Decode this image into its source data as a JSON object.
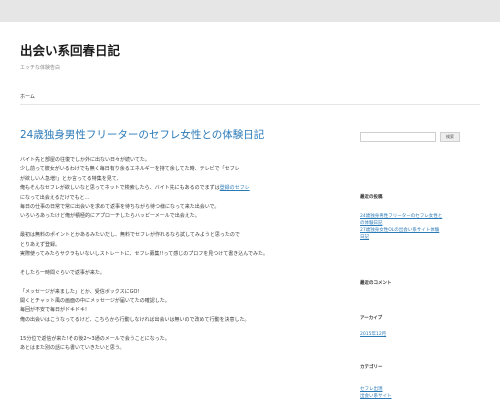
{
  "site": {
    "title": "出会い系回春日記",
    "description": "エッチな体験告白"
  },
  "nav": {
    "home": "ホーム"
  },
  "post": {
    "title": "24歳独身男性フリーターのセフレ女性との体験日記",
    "lines": [
      {
        "text": "バイト先と部屋の往復でしか外に出ない日々が続いてた。"
      },
      {
        "text": "少し前って彼女がいるわけでも無く毎日有り余るエネルギーを持て余してた時、テレビで「セフレ"
      },
      {
        "text": "が欲しい人急増!」とか言ってる特集を見て、"
      },
      {
        "text": "俺もそんなセフレが欲しいなと思ってネットで検索したら、バイト先にもあるのでまずは",
        "link": "登録のセフレ"
      },
      {
        "text": "になって出会えるだけでもと…"
      },
      {
        "text": "毎日の仕事の日常で常に出会いを求めて返事を待ちながら待つ様になって来た出会いで。"
      },
      {
        "text": "いろいろあったけど俺が積極的にアプローチしたらハッピーメールで出会えた。"
      },
      {
        "text": ""
      },
      {
        "text": "最初は無料のポイントとかあるみたいだし、無料でセフレが作れるなら試してみようと思ったので"
      },
      {
        "text": "とりあえず登録。"
      },
      {
        "text": "実際使ってみたらサクラもいないしストレートに、セフレ募集!!って感じのプロフを見つけて書き込んでみた。"
      },
      {
        "text": ""
      },
      {
        "text": "そしたら一時間ぐらいで返事が来た。"
      },
      {
        "text": ""
      },
      {
        "text": "「メッセージが来ました」とか、受信ボックスにGO!"
      },
      {
        "text": "開くとチャット風の画面の中にメッセージが届いてたの確認した。"
      },
      {
        "text": "毎回が不安で毎日がドキドキ!"
      },
      {
        "text": "俺の出会いはこうなってるけど、こちらから行動しなければ出会いは無いので改めて行動を決意した。"
      },
      {
        "text": ""
      },
      {
        "text": "15分位で返信が来た!その後2～3通のメールで会うことになった。"
      },
      {
        "text": "あとはまた別の話にも書いていきたいと思う。"
      }
    ]
  },
  "sidebar": {
    "search_button": "検索",
    "search_value": "",
    "recent_posts_title": "最近の投稿",
    "recent_posts": [
      "24歳独身男性フリーターのセフレ女性と",
      "の体験日記",
      "27歳独身女性OLの出会い系サイト体験",
      "日記"
    ],
    "recent_comments_title": "最近のコメント",
    "archives_title": "アーカイブ",
    "archives": [
      "2015年12月"
    ],
    "categories_title": "カテゴリー",
    "categories": [
      "セフレ出現",
      "出会い系サイト"
    ]
  }
}
